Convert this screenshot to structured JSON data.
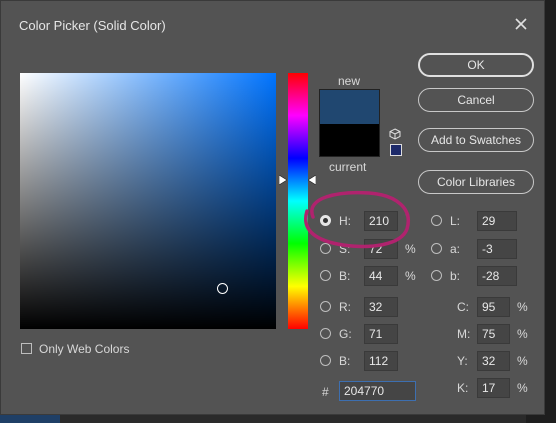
{
  "window": {
    "title": "Color Picker (Solid Color)"
  },
  "colors": {
    "new": "#204770",
    "current": "#000000",
    "field_hue": "#0074ff",
    "annotation": "#b0236e"
  },
  "icons": {
    "close": "close-icon",
    "cube": "cube-icon"
  },
  "preview": {
    "new_label": "new",
    "current_label": "current"
  },
  "buttons": {
    "ok": "OK",
    "cancel": "Cancel",
    "add_to_swatches": "Add to Swatches",
    "color_libraries": "Color Libraries"
  },
  "options": {
    "only_web_colors": "Only Web Colors",
    "only_web_colors_checked": false
  },
  "hsb": {
    "h": {
      "label": "H:",
      "value": "210",
      "unit": "°",
      "selected": true
    },
    "s": {
      "label": "S:",
      "value": "72",
      "unit": "%"
    },
    "b": {
      "label": "B:",
      "value": "44",
      "unit": "%"
    }
  },
  "rgb": {
    "r": {
      "label": "R:",
      "value": "32"
    },
    "g": {
      "label": "G:",
      "value": "71"
    },
    "b": {
      "label": "B:",
      "value": "112"
    }
  },
  "hex": {
    "label": "#",
    "value": "204770"
  },
  "lab": {
    "l": {
      "label": "L:",
      "value": "29"
    },
    "a": {
      "label": "a:",
      "value": "-3"
    },
    "b": {
      "label": "b:",
      "value": "-28"
    }
  },
  "cmyk": {
    "c": {
      "label": "C:",
      "value": "95",
      "unit": "%"
    },
    "m": {
      "label": "M:",
      "value": "75",
      "unit": "%"
    },
    "y": {
      "label": "Y:",
      "value": "32",
      "unit": "%"
    },
    "k": {
      "label": "K:",
      "value": "17",
      "unit": "%"
    }
  }
}
